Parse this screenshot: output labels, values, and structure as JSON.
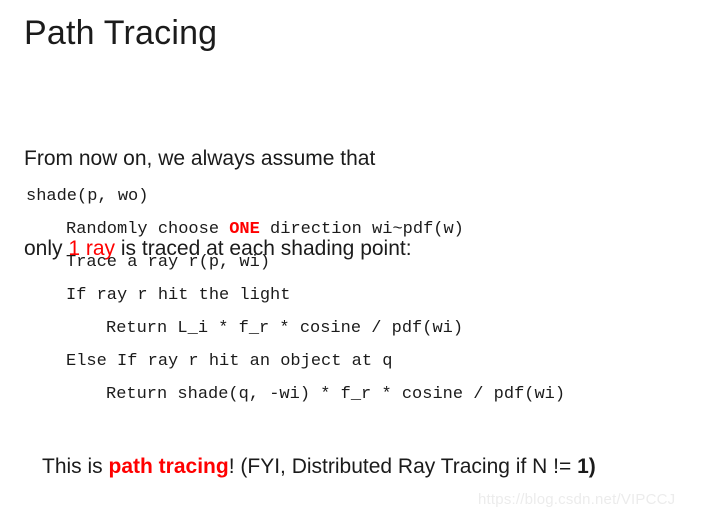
{
  "slide": {
    "title": "Path Tracing",
    "intro": {
      "line1": "From now on, we always assume that",
      "line2_pre": "only ",
      "line2_accent": "1 ray",
      "line2_post": " is traced at each shading point:"
    },
    "code": {
      "line1": "shade(p, wo)",
      "line2_pre": "Randomly choose ",
      "line2_keyword": "ONE",
      "line2_post": " direction wi~pdf(w)",
      "line3": "Trace a ray r(p, wi)",
      "line4": "If ray r hit the light",
      "line5": "Return L_i * f_r * cosine / pdf(wi)",
      "line6": "Else If ray r hit an object at q",
      "line7": "Return shade(q, -wi) * f_r * cosine / pdf(wi)"
    },
    "conclusion": {
      "pre": "This is ",
      "emphasis": "path tracing",
      "mid": "! (FYI, Distributed Ray Tracing if N != ",
      "bold_end": "1)"
    },
    "watermark": "https://blog.csdn.net/VIPCCJ",
    "colors": {
      "text": "#1b1b1b",
      "accent_red": "#ff0000",
      "background": "#ffffff",
      "watermark": "#ececec"
    }
  }
}
